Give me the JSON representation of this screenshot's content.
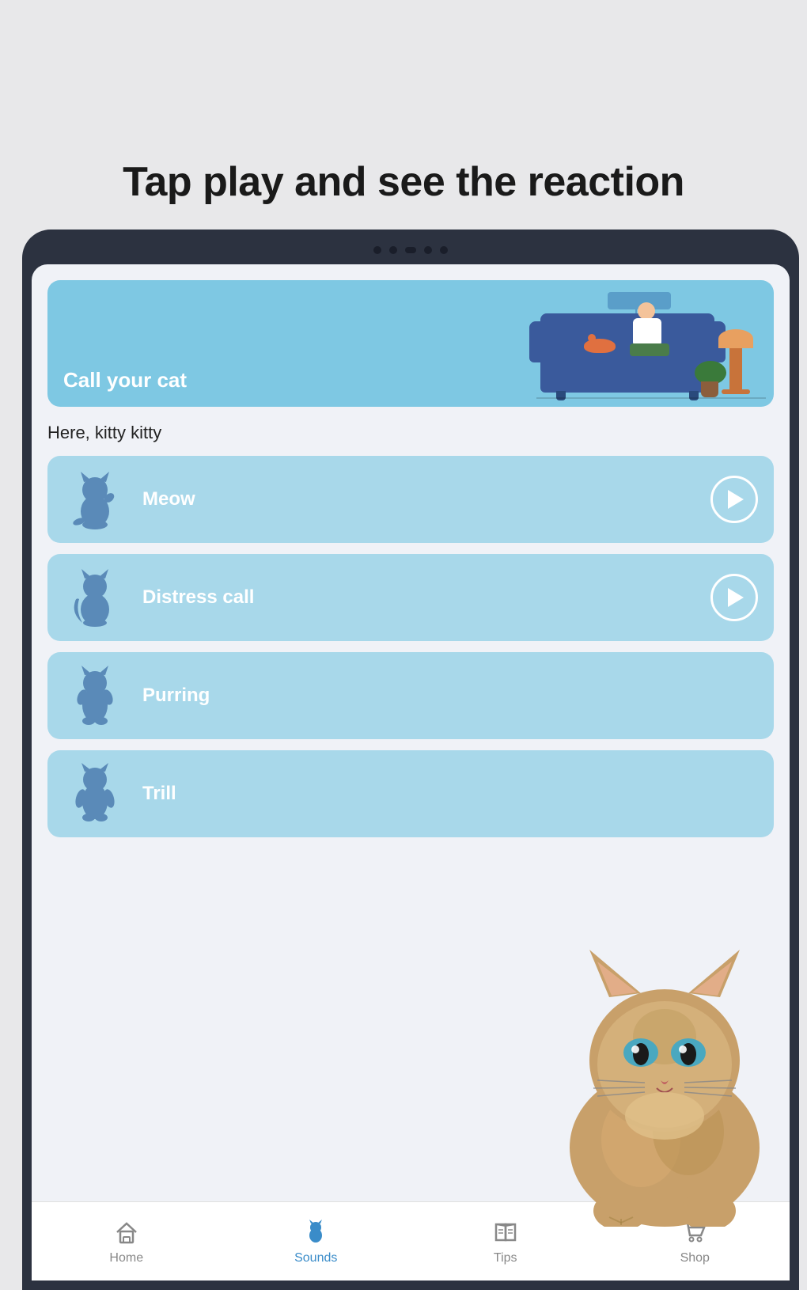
{
  "page": {
    "heading": "Tap play and see the reaction",
    "banner": {
      "title": "Call your cat"
    },
    "subtitle": "Here, kitty kitty",
    "sounds": [
      {
        "id": 1,
        "name": "Meow",
        "hasPlay": true
      },
      {
        "id": 2,
        "name": "Distress call",
        "hasPlay": true
      },
      {
        "id": 3,
        "name": "Purring",
        "hasPlay": false
      },
      {
        "id": 4,
        "name": "Trill",
        "hasPlay": false
      }
    ],
    "nav": {
      "items": [
        {
          "id": "home",
          "label": "Home",
          "active": false
        },
        {
          "id": "sounds",
          "label": "Sounds",
          "active": true
        },
        {
          "id": "tips",
          "label": "Tips",
          "active": false
        },
        {
          "id": "shop",
          "label": "Shop",
          "active": false
        }
      ]
    }
  }
}
